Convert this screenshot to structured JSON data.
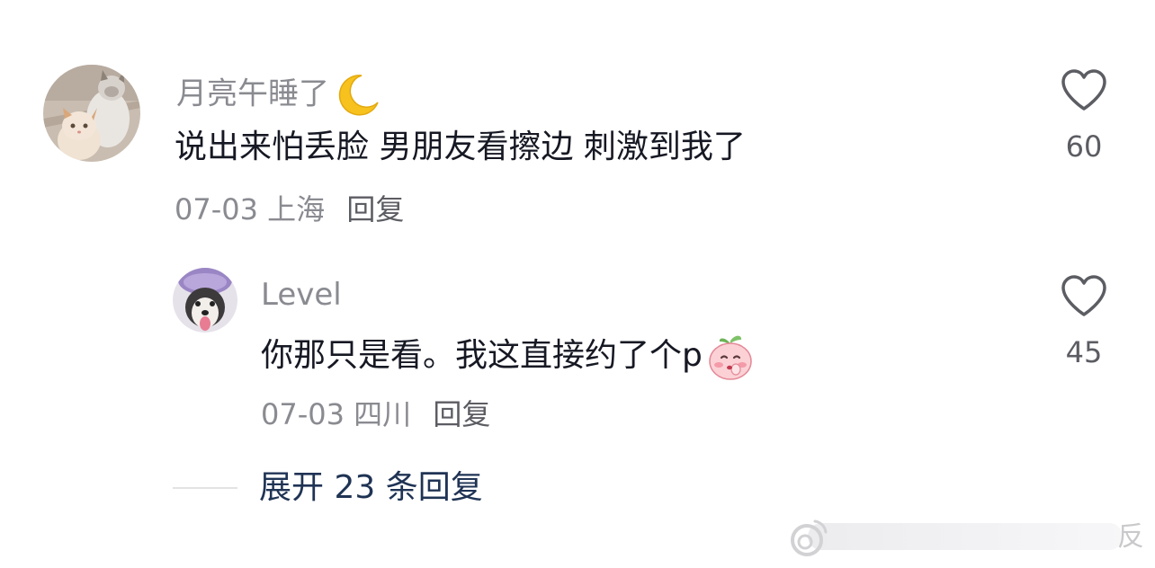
{
  "comments": [
    {
      "username": "月亮午睡了",
      "username_emoji": "crescent-moon-emoji",
      "avatar": "two-cats-avatar",
      "text": "说出来怕丢脸  男朋友看擦边  刺激到我了",
      "date": "07-03",
      "location": "上海",
      "reply_label": "回复",
      "like_count": "60"
    },
    {
      "username": "Level",
      "avatar": "husky-dog-avatar",
      "text": "你那只是看。我这直接约了个p",
      "text_emoji": "shy-peach-emoji",
      "date": "07-03",
      "location": "四川",
      "reply_label": "回复",
      "like_count": "45"
    }
  ],
  "expand_replies_label": "展开 23 条回复",
  "watermark_text": "反",
  "icons": {
    "like": "heart-outline-icon",
    "watermark_logo": "weibo-logo-icon"
  },
  "colors": {
    "text_primary": "#161823",
    "text_secondary": "#8a8b91",
    "link_dark": "#1f3354"
  }
}
